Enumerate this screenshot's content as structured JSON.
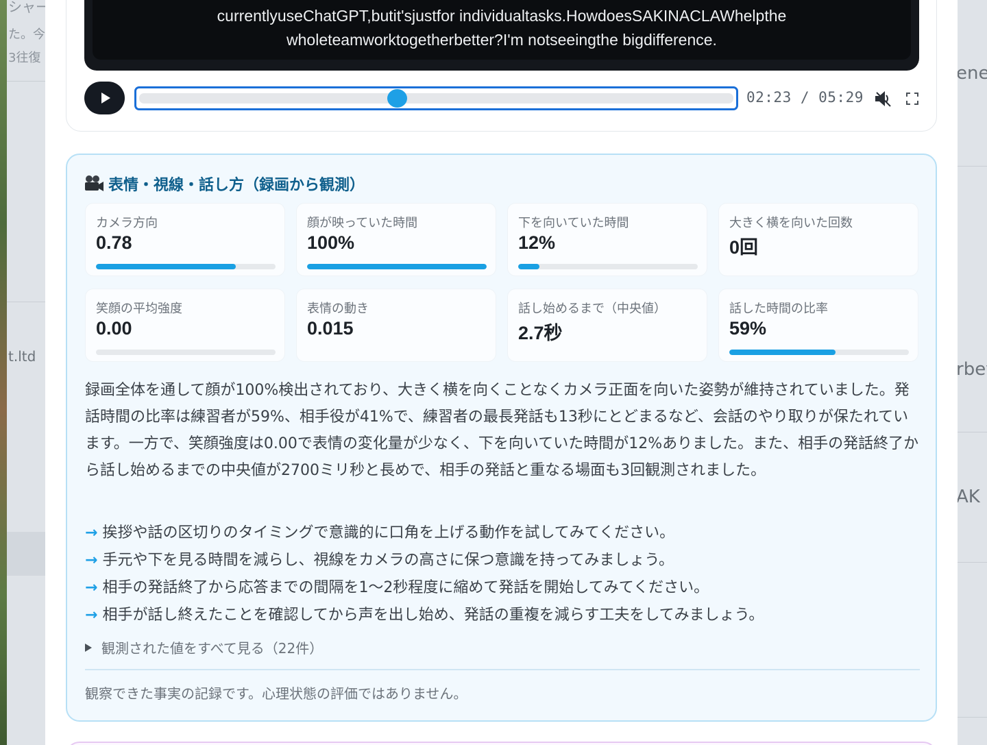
{
  "background": {
    "left_fragments": [
      "シャー",
      "た。今",
      "3往復",
      "t.ltd"
    ],
    "right_fragments": [
      "ener",
      "rbev",
      "AK"
    ]
  },
  "video": {
    "subtitle_lines": [
      "currentlyuseChatGPT,butit'sjustfor individualtasks.HowdoesSAKINACLAWhelpthe",
      "wholeteamworktogetherbetter?I'm notseeingthe bigdifference."
    ],
    "time": "02:23 / 05:29",
    "progress": 0.434
  },
  "observation": {
    "title": "表情・視線・話し方（録画から観測）",
    "metrics": [
      {
        "label": "カメラ方向",
        "value": "0.78",
        "fill": 0.78
      },
      {
        "label": "顔が映っていた時間",
        "value": "100%",
        "fill": 1.0
      },
      {
        "label": "下を向いていた時間",
        "value": "12%",
        "fill": 0.12
      },
      {
        "label": "大きく横を向いた回数",
        "value": "0回"
      },
      {
        "label": "笑顔の平均強度",
        "value": "0.00",
        "fill": 0.0
      },
      {
        "label": "表情の動き",
        "value": "0.015"
      },
      {
        "label": "話し始めるまで（中央値）",
        "value": "2.7秒"
      },
      {
        "label": "話した時間の比率",
        "value": "59%",
        "fill": 0.59
      }
    ],
    "summary": "録画全体を通して顔が100%検出されており、大きく横を向くことなくカメラ正面を向いた姿勢が維持されていました。発話時間の比率は練習者が59%、相手役が41%で、練習者の最長発話も13秒にとどまるなど、会話のやり取りが保たれています。一方で、笑顔強度は0.00で表情の変化量が少なく、下を向いていた時間が12%ありました。また、相手の発話終了から話し始めるまでの中央値が2700ミリ秒と長めで、相手の発話と重なる場面も3回観測されました。",
    "tips": [
      "挨拶や話の区切りのタイミングで意識的に口角を上げる動作を試してみてください。",
      "手元や下を見る時間を減らし、視線をカメラの高さに保つ意識を持ってみましょう。",
      "相手の発話終了から応答までの間隔を1〜2秒程度に縮めて発話を開始してみてください。",
      "相手が話し終えたことを確認してから声を出し始め、発話の重複を減らす工夫をしてみましょう。"
    ],
    "details_label": "観測された値をすべて見る（22件）",
    "footnote": "観察できた事実の記録です。心理状態の評価ではありません。"
  },
  "colors": {
    "accent": "#1aa0e3",
    "title": "#0f5f8c",
    "panel_bg": "#f2f9fe",
    "panel_border": "#b7e0f6"
  }
}
